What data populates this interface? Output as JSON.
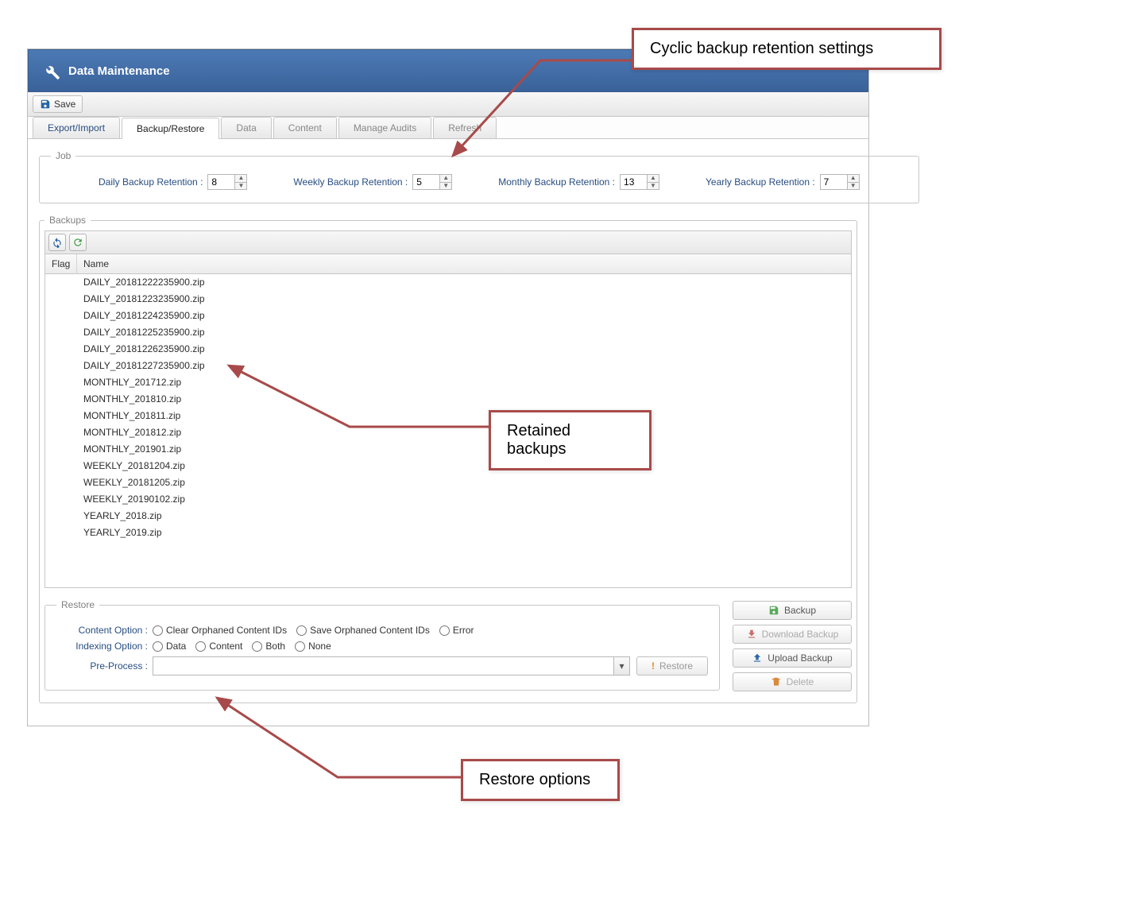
{
  "header": {
    "title": "Data Maintenance"
  },
  "toolbar": {
    "save_label": "Save"
  },
  "tabs": [
    {
      "label": "Export/Import",
      "active": false
    },
    {
      "label": "Backup/Restore",
      "active": true
    },
    {
      "label": "Data",
      "active": false,
      "disabled": true
    },
    {
      "label": "Content",
      "active": false,
      "disabled": true
    },
    {
      "label": "Manage Audits",
      "active": false,
      "disabled": true
    },
    {
      "label": "Refresh",
      "active": false,
      "disabled": true
    }
  ],
  "job": {
    "legend": "Job",
    "daily": {
      "label": "Daily Backup Retention :",
      "value": "8"
    },
    "weekly": {
      "label": "Weekly Backup Retention :",
      "value": "5"
    },
    "monthly": {
      "label": "Monthly Backup Retention :",
      "value": "13"
    },
    "yearly": {
      "label": "Yearly Backup Retention :",
      "value": "7"
    }
  },
  "backups": {
    "legend": "Backups",
    "columns": {
      "flag": "Flag",
      "name": "Name"
    },
    "rows": [
      {
        "name": "DAILY_20181222235900.zip"
      },
      {
        "name": "DAILY_20181223235900.zip"
      },
      {
        "name": "DAILY_20181224235900.zip"
      },
      {
        "name": "DAILY_20181225235900.zip"
      },
      {
        "name": "DAILY_20181226235900.zip"
      },
      {
        "name": "DAILY_20181227235900.zip"
      },
      {
        "name": "MONTHLY_201712.zip"
      },
      {
        "name": "MONTHLY_201810.zip"
      },
      {
        "name": "MONTHLY_201811.zip"
      },
      {
        "name": "MONTHLY_201812.zip"
      },
      {
        "name": "MONTHLY_201901.zip"
      },
      {
        "name": "WEEKLY_20181204.zip"
      },
      {
        "name": "WEEKLY_20181205.zip"
      },
      {
        "name": "WEEKLY_20190102.zip"
      },
      {
        "name": "YEARLY_2018.zip"
      },
      {
        "name": "YEARLY_2019.zip"
      }
    ]
  },
  "restore": {
    "legend": "Restore",
    "content_label": "Content Option :",
    "content_options": [
      "Clear Orphaned Content IDs",
      "Save Orphaned Content IDs",
      "Error"
    ],
    "indexing_label": "Indexing Option :",
    "indexing_options": [
      "Data",
      "Content",
      "Both",
      "None"
    ],
    "preprocess_label": "Pre-Process :",
    "preprocess_value": "",
    "restore_button": "Restore"
  },
  "actions": {
    "backup": "Backup",
    "download": "Download Backup",
    "upload": "Upload Backup",
    "delete": "Delete"
  },
  "annotations": {
    "cyclic": "Cyclic backup retention settings",
    "retained": "Retained backups",
    "restore_opts": "Restore options"
  }
}
